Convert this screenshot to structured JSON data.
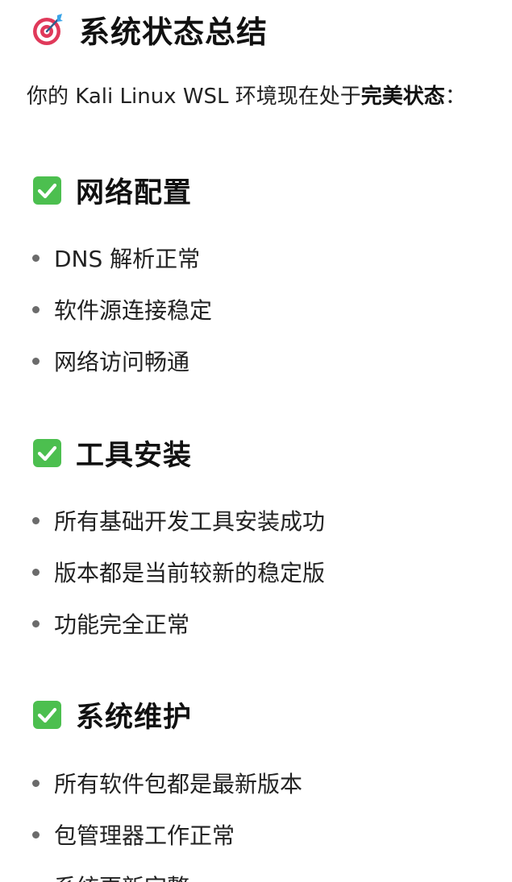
{
  "title": {
    "icon": "target-icon",
    "text": "系统状态总结"
  },
  "intro": {
    "prefix": "你的 Kali Linux WSL 环境现在处于",
    "bold": "完美状态",
    "suffix": "："
  },
  "sections": [
    {
      "icon": "check-box-icon",
      "title": "网络配置",
      "items": [
        "DNS 解析正常",
        "软件源连接稳定",
        "网络访问畅通"
      ]
    },
    {
      "icon": "check-box-icon",
      "title": "工具安装",
      "items": [
        "所有基础开发工具安装成功",
        "版本都是当前较新的稳定版",
        "功能完全正常"
      ]
    },
    {
      "icon": "check-box-icon",
      "title": "系统维护",
      "items": [
        "所有软件包都是最新版本",
        "包管理器工作正常",
        "系统更新完整"
      ]
    }
  ],
  "colors": {
    "check_green": "#4cbf4f",
    "target_red": "#e0395a",
    "dart_blue": "#3aa4e8"
  }
}
